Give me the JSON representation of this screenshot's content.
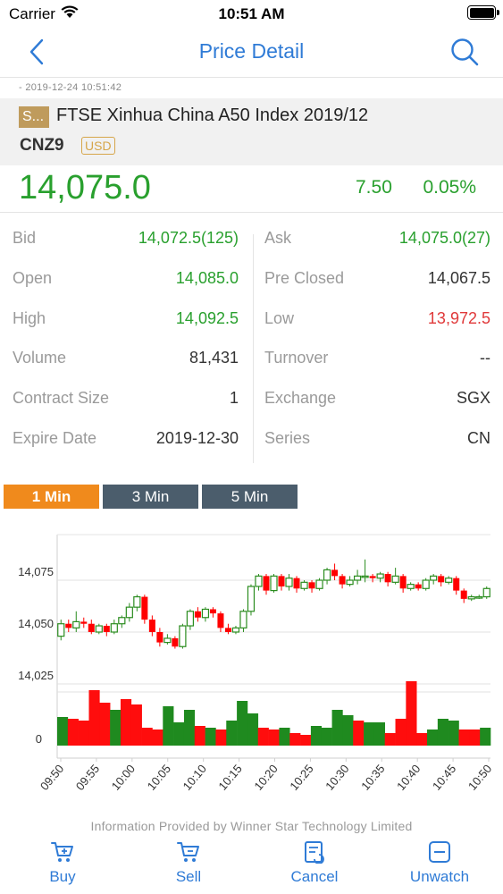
{
  "status_bar": {
    "carrier": "Carrier",
    "time": "10:51 AM"
  },
  "nav": {
    "title": "Price Detail",
    "back_icon": "chevron-left-icon",
    "search_icon": "search-icon"
  },
  "timestamp": "-   2019-12-24 10:51:42",
  "product": {
    "tag": "S...",
    "name": "FTSE Xinhua China A50 Index 2019/12",
    "code": "CNZ9",
    "currency": "USD"
  },
  "price": {
    "last": "14,075.0",
    "change": "7.50",
    "change_pct": "0.05%"
  },
  "stats": {
    "left": [
      {
        "label": "Bid",
        "value": "14,072.5(125)",
        "color": "green"
      },
      {
        "label": "Open",
        "value": "14,085.0",
        "color": "green"
      },
      {
        "label": "High",
        "value": "14,092.5",
        "color": "green"
      },
      {
        "label": "Volume",
        "value": "81,431",
        "color": "dark"
      },
      {
        "label": "Contract Size",
        "value": "1",
        "color": "dark"
      },
      {
        "label": "Expire Date",
        "value": "2019-12-30",
        "color": "dark"
      }
    ],
    "right": [
      {
        "label": "Ask",
        "value": "14,075.0(27)",
        "color": "green"
      },
      {
        "label": "Pre Closed",
        "value": "14,067.5",
        "color": "dark"
      },
      {
        "label": "Low",
        "value": "13,972.5",
        "color": "red"
      },
      {
        "label": "Turnover",
        "value": "--",
        "color": "dark"
      },
      {
        "label": "Exchange",
        "value": "SGX",
        "color": "dark"
      },
      {
        "label": "Series",
        "value": "CN",
        "color": "dark"
      }
    ]
  },
  "intervals": [
    {
      "label": "1 Min",
      "active": true
    },
    {
      "label": "3 Min",
      "active": false
    },
    {
      "label": "5 Min",
      "active": false
    }
  ],
  "chart_data": {
    "type": "candlestick",
    "ytick_labels": [
      "14,075",
      "14,050",
      "14,025",
      "0"
    ],
    "price_ticks": [
      14075,
      14050,
      14025
    ],
    "xtick_labels": [
      "09:50",
      "09:55",
      "10:00",
      "10:05",
      "10:10",
      "10:15",
      "10:20",
      "10:25",
      "10:30",
      "10:35",
      "10:40",
      "10:45",
      "10:50"
    ],
    "up_color": "#2a8c1e",
    "down_color": "#ff0000",
    "candles": [
      [
        14048,
        14054,
        14046,
        14056,
        "up"
      ],
      [
        14054,
        14052,
        14050,
        14056,
        "down"
      ],
      [
        14052,
        14055,
        14050,
        14060,
        "up"
      ],
      [
        14055,
        14054,
        14052,
        14057,
        "down"
      ],
      [
        14054,
        14050,
        14049,
        14056,
        "down"
      ],
      [
        14050,
        14053,
        14049,
        14054,
        "up"
      ],
      [
        14053,
        14050,
        14048,
        14054,
        "down"
      ],
      [
        14050,
        14054,
        14049,
        14056,
        "up"
      ],
      [
        14054,
        14057,
        14052,
        14058,
        "up"
      ],
      [
        14057,
        14062,
        14055,
        14064,
        "up"
      ],
      [
        14062,
        14067,
        14060,
        14068,
        "up"
      ],
      [
        14067,
        14056,
        14054,
        14068,
        "down"
      ],
      [
        14056,
        14050,
        14048,
        14058,
        "down"
      ],
      [
        14050,
        14045,
        14043,
        14052,
        "down"
      ],
      [
        14045,
        14047,
        14044,
        14049,
        "up"
      ],
      [
        14047,
        14043,
        14042,
        14048,
        "down"
      ],
      [
        14043,
        14053,
        14042,
        14054,
        "up"
      ],
      [
        14053,
        14060,
        14051,
        14061,
        "up"
      ],
      [
        14060,
        14057,
        14055,
        14062,
        "down"
      ],
      [
        14057,
        14061,
        14055,
        14062,
        "up"
      ],
      [
        14061,
        14059,
        14057,
        14062,
        "down"
      ],
      [
        14059,
        14052,
        14050,
        14060,
        "down"
      ],
      [
        14052,
        14050,
        14049,
        14054,
        "down"
      ],
      [
        14050,
        14052,
        14049,
        14053,
        "up"
      ],
      [
        14052,
        14060,
        14050,
        14061,
        "up"
      ],
      [
        14060,
        14072,
        14058,
        14073,
        "up"
      ],
      [
        14072,
        14077,
        14070,
        14078,
        "up"
      ],
      [
        14077,
        14070,
        14068,
        14078,
        "down"
      ],
      [
        14070,
        14077,
        14069,
        14078,
        "up"
      ],
      [
        14077,
        14072,
        14070,
        14078,
        "down"
      ],
      [
        14072,
        14076,
        14070,
        14078,
        "up"
      ],
      [
        14076,
        14071,
        14069,
        14077,
        "down"
      ],
      [
        14071,
        14074,
        14070,
        14075,
        "up"
      ],
      [
        14074,
        14071,
        14069,
        14075,
        "down"
      ],
      [
        14071,
        14075,
        14070,
        14076,
        "up"
      ],
      [
        14075,
        14080,
        14073,
        14081,
        "up"
      ],
      [
        14080,
        14077,
        14075,
        14083,
        "down"
      ],
      [
        14077,
        14073,
        14071,
        14078,
        "down"
      ],
      [
        14073,
        14075,
        14072,
        14077,
        "up"
      ],
      [
        14075,
        14077,
        14073,
        14080,
        "up"
      ],
      [
        14077,
        14077,
        14074,
        14085,
        "up"
      ],
      [
        14077,
        14076,
        14074,
        14078,
        "down"
      ],
      [
        14076,
        14078,
        14074,
        14079,
        "up"
      ],
      [
        14078,
        14074,
        14072,
        14079,
        "down"
      ],
      [
        14074,
        14077,
        14073,
        14081,
        "up"
      ],
      [
        14077,
        14071,
        14069,
        14078,
        "down"
      ],
      [
        14071,
        14073,
        14070,
        14074,
        "up"
      ],
      [
        14073,
        14071,
        14070,
        14074,
        "down"
      ],
      [
        14071,
        14075,
        14070,
        14076,
        "up"
      ],
      [
        14075,
        14077,
        14073,
        14078,
        "up"
      ],
      [
        14077,
        14074,
        14072,
        14078,
        "down"
      ],
      [
        14074,
        14076,
        14073,
        14077,
        "up"
      ],
      [
        14076,
        14070,
        14068,
        14077,
        "down"
      ],
      [
        14070,
        14066,
        14064,
        14071,
        "down"
      ],
      [
        14066,
        14067,
        14065,
        14068,
        "up"
      ],
      [
        14067,
        14067,
        14066,
        14068,
        "up"
      ],
      [
        14067,
        14071,
        14066,
        14072,
        "up"
      ]
    ],
    "volumes": [
      [
        32,
        "up"
      ],
      [
        30,
        "down"
      ],
      [
        28,
        "down"
      ],
      [
        62,
        "down"
      ],
      [
        48,
        "down"
      ],
      [
        40,
        "up"
      ],
      [
        52,
        "down"
      ],
      [
        46,
        "down"
      ],
      [
        20,
        "down"
      ],
      [
        18,
        "down"
      ],
      [
        44,
        "up"
      ],
      [
        26,
        "up"
      ],
      [
        40,
        "up"
      ],
      [
        22,
        "down"
      ],
      [
        20,
        "up"
      ],
      [
        18,
        "down"
      ],
      [
        28,
        "up"
      ],
      [
        50,
        "up"
      ],
      [
        36,
        "up"
      ],
      [
        20,
        "down"
      ],
      [
        18,
        "down"
      ],
      [
        20,
        "up"
      ],
      [
        14,
        "down"
      ],
      [
        12,
        "down"
      ],
      [
        22,
        "up"
      ],
      [
        20,
        "up"
      ],
      [
        40,
        "up"
      ],
      [
        34,
        "up"
      ],
      [
        28,
        "down"
      ],
      [
        26,
        "up"
      ],
      [
        26,
        "up"
      ],
      [
        14,
        "down"
      ],
      [
        30,
        "down"
      ],
      [
        72,
        "down"
      ],
      [
        14,
        "down"
      ],
      [
        18,
        "up"
      ],
      [
        30,
        "up"
      ],
      [
        28,
        "up"
      ],
      [
        18,
        "down"
      ],
      [
        18,
        "down"
      ],
      [
        20,
        "up"
      ]
    ]
  },
  "footer_note": "Information Provided by Winner Star Technology Limited",
  "actions": [
    {
      "label": "Buy",
      "icon": "cart-buy-icon"
    },
    {
      "label": "Sell",
      "icon": "cart-sell-icon"
    },
    {
      "label": "Cancel",
      "icon": "cancel-order-icon"
    },
    {
      "label": "Unwatch",
      "icon": "unwatch-icon"
    }
  ],
  "colors": {
    "accent": "#2f7bd6",
    "up": "#29a02e",
    "down": "#e0393a",
    "tab_active": "#f08a1c",
    "tab_inactive": "#4b5d6c",
    "tag": "#bf9b5c"
  }
}
